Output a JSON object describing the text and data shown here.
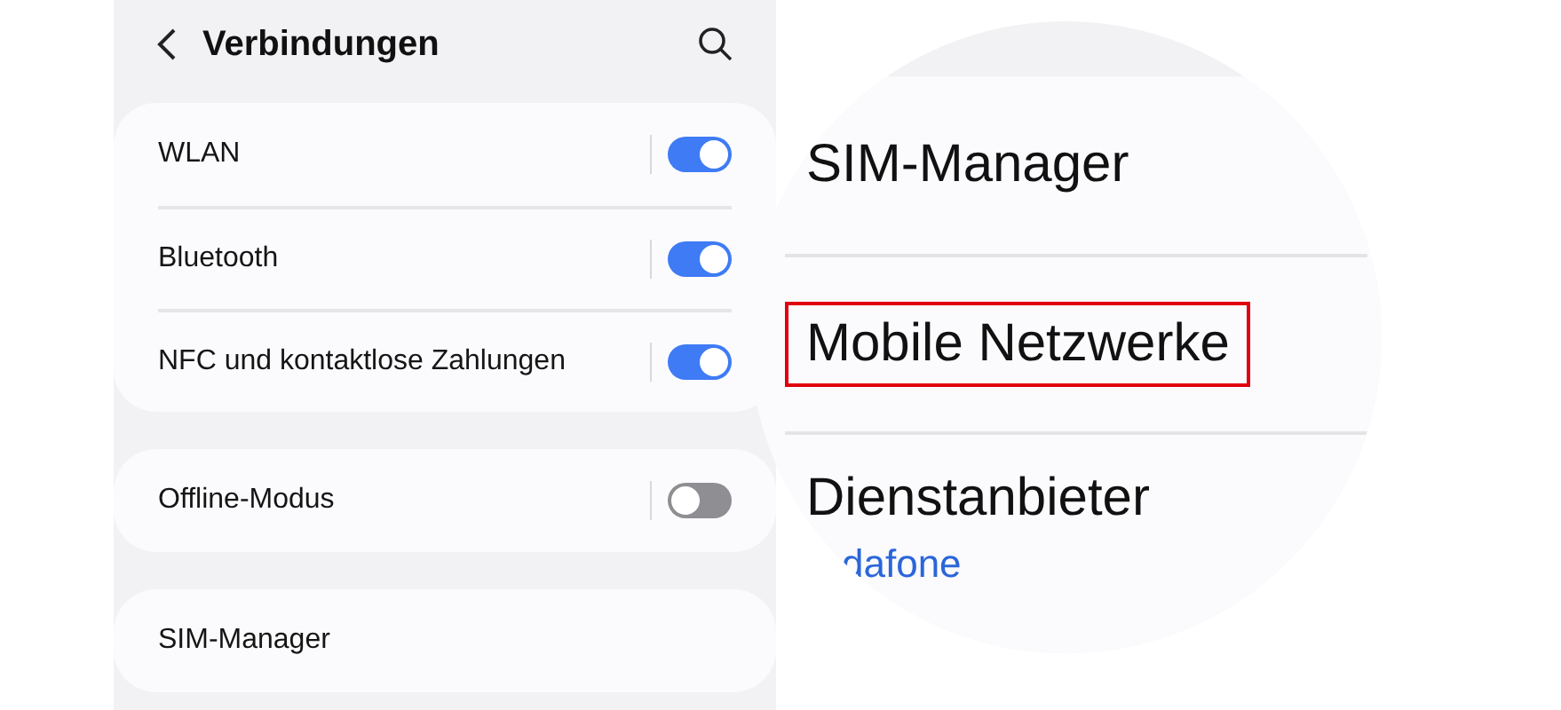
{
  "header": {
    "title": "Verbindungen"
  },
  "groups": [
    {
      "items": [
        {
          "label": "WLAN",
          "kind": "toggle",
          "on": true
        },
        {
          "label": "Bluetooth",
          "kind": "toggle",
          "on": true
        },
        {
          "label": "NFC und kontaktlose Zahlungen",
          "kind": "toggle",
          "on": true
        }
      ]
    },
    {
      "items": [
        {
          "label": "Offline-Modus",
          "kind": "toggle",
          "on": false
        }
      ]
    },
    {
      "items": [
        {
          "label": "SIM-Manager",
          "kind": "link"
        }
      ]
    }
  ],
  "magnifier": {
    "items": [
      {
        "label": "SIM-Manager",
        "highlighted": false
      },
      {
        "label": "Mobile Netzwerke",
        "highlighted": true
      },
      {
        "label": "Dienstanbieter",
        "sublabel": "dafone",
        "highlighted": false
      }
    ]
  }
}
